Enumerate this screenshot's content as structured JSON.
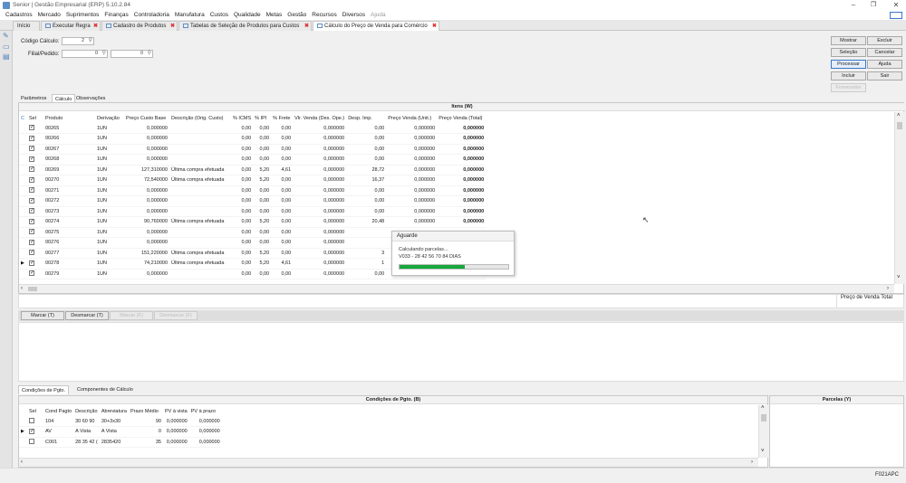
{
  "window": {
    "title": "Senior | Gestão Empresarial (ERP) 5.10.2.84"
  },
  "menu": [
    "Cadastros",
    "Mercado",
    "Suprimentos",
    "Finanças",
    "Controladoria",
    "Manufatura",
    "Custos",
    "Qualidade",
    "Metas",
    "Gestão",
    "Recursos",
    "Diversos",
    "Ajuda"
  ],
  "tabs": [
    {
      "label": "Início"
    },
    {
      "label": "Executar Regra"
    },
    {
      "label": "Cadastro de Produtos"
    },
    {
      "label": "Tabelas de Seleção de Produtos para Custos"
    },
    {
      "label": "Cálculo do Preço de Venda para Comércio"
    }
  ],
  "form": {
    "codigo_label": "Código Cálculo:",
    "codigo_value": "2",
    "filial_label": "Filial/Pedido:",
    "filial_value": "0",
    "pedido_value": "0"
  },
  "actions": {
    "mostrar": "Mostrar",
    "excluir": "Excluir",
    "selecao": "Seleção",
    "cancelar": "Cancelar",
    "processar": "Processar",
    "ajuda": "Ajuda",
    "incluir": "Incluir",
    "sair": "Sair",
    "extra": "Fornecedor"
  },
  "subtabs": [
    "Parâmetros",
    "Cálculo",
    "Observações"
  ],
  "items_grid": {
    "title": "Itens (W)",
    "columns": [
      "Sel",
      "Produto",
      "Derivação",
      "Preço Custo Base",
      "Descrição (Orig. Custo)",
      "% ICMS",
      "% IPI",
      "% Frete",
      "Vlr. Venda (Des. Ope.)",
      "Desp. Imp.",
      "Preço Venda (Unit.)",
      "Preço Venda (Total)"
    ],
    "rows": [
      [
        "00265",
        "1UN",
        "0,000000",
        "",
        "0,00",
        "0,00",
        "0,00",
        "0,000000",
        "0,00",
        "0,000000",
        "0,000000"
      ],
      [
        "00266",
        "1UN",
        "0,000000",
        "",
        "0,00",
        "0,00",
        "0,00",
        "0,000000",
        "0,00",
        "0,000000",
        "0,000000"
      ],
      [
        "00267",
        "1UN",
        "0,000000",
        "",
        "0,00",
        "0,00",
        "0,00",
        "0,000000",
        "0,00",
        "0,000000",
        "0,000000"
      ],
      [
        "00268",
        "1UN",
        "0,000000",
        "",
        "0,00",
        "0,00",
        "0,00",
        "0,000000",
        "0,00",
        "0,000000",
        "0,000000"
      ],
      [
        "00269",
        "1UN",
        "127,310000",
        "Última compra efetuada",
        "0,00",
        "5,20",
        "4,61",
        "0,000000",
        "28,72",
        "0,000000",
        "0,000000"
      ],
      [
        "00270",
        "1UN",
        "72,540000",
        "Última compra efetuada",
        "0,00",
        "5,20",
        "0,00",
        "0,000000",
        "16,37",
        "0,000000",
        "0,000000"
      ],
      [
        "00271",
        "1UN",
        "0,000000",
        "",
        "0,00",
        "0,00",
        "0,00",
        "0,000000",
        "0,00",
        "0,000000",
        "0,000000"
      ],
      [
        "00272",
        "1UN",
        "0,000000",
        "",
        "0,00",
        "0,00",
        "0,00",
        "0,000000",
        "0,00",
        "0,000000",
        "0,000000"
      ],
      [
        "00273",
        "1UN",
        "0,000000",
        "",
        "0,00",
        "0,00",
        "0,00",
        "0,000000",
        "0,00",
        "0,000000",
        "0,000000"
      ],
      [
        "00274",
        "1UN",
        "90,760000",
        "Última compra efetuada",
        "0,00",
        "5,20",
        "0,00",
        "0,000000",
        "20,48",
        "0,000000",
        "0,000000"
      ],
      [
        "00275",
        "1UN",
        "0,000000",
        "",
        "0,00",
        "0,00",
        "0,00",
        "0,000000",
        "",
        "",
        ""
      ],
      [
        "00276",
        "1UN",
        "0,000000",
        "",
        "0,00",
        "0,00",
        "0,00",
        "0,000000",
        "",
        "",
        ""
      ],
      [
        "00277",
        "1UN",
        "151,220000",
        "Última compra efetuada",
        "0,00",
        "5,20",
        "0,00",
        "0,000000",
        "3",
        "",
        ""
      ],
      [
        "00278",
        "1UN",
        "74,210000",
        "Última compra efetuada",
        "0,00",
        "5,20",
        "4,61",
        "0,000000",
        "1",
        "",
        ""
      ],
      [
        "00279",
        "1UN",
        "0,000000",
        "",
        "0,00",
        "0,00",
        "0,00",
        "0,000000",
        "0,00",
        "0,000000",
        "0,000000"
      ]
    ]
  },
  "dialog": {
    "title": "Aguarde",
    "line1": "Calculando parcelas...",
    "line2": "V033 - 28 42 56 70 84 DIAS",
    "progress": 0.6
  },
  "total": {
    "label": "Preço de Venda Total"
  },
  "mark_buttons": {
    "marcar": "Marcar (T)",
    "desmarcar": "Desmarcar (T)",
    "b3": "Marcar (F)",
    "b4": "Desmarcar (F)"
  },
  "bottom_tabs": [
    "Condições de Pgto.",
    "Componentes de Cálculo"
  ],
  "cond_grid": {
    "title": "Condições de Pgto. (B)",
    "columns": [
      "Sel",
      "Cond Pagto",
      "Descrição",
      "Abreviatura",
      "Prazo Médio",
      "PV à vista",
      "PV à prazo"
    ],
    "rows": [
      {
        "sel": false,
        "ptr": false,
        "cells": [
          "104",
          "30 60 90",
          "30+3x30",
          "90",
          "0,000000",
          "0,000000"
        ]
      },
      {
        "sel": true,
        "ptr": true,
        "cells": [
          "AV",
          "A Vista",
          "A Vista",
          "0",
          "0,000000",
          "0,000000"
        ]
      },
      {
        "sel": false,
        "ptr": false,
        "cells": [
          "C001",
          "28 35 42 (",
          "2835420",
          "35",
          "0,000000",
          "0,000000"
        ]
      }
    ]
  },
  "parcelas": {
    "title": "Parcelas (Y)"
  },
  "status": {
    "code": "F021APC"
  }
}
